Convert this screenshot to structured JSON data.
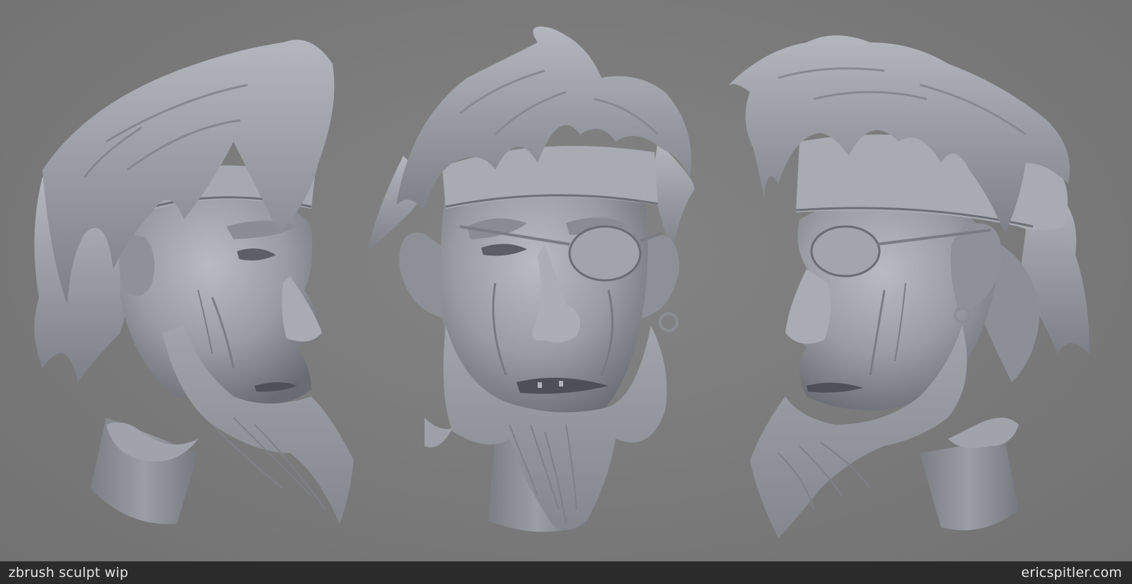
{
  "caption": {
    "left_text": "zbrush sculpt wip",
    "right_text": "ericspitler.com"
  },
  "image": {
    "subjects": [
      "bust-left-profile",
      "bust-front",
      "bust-right-profile"
    ],
    "colors": {
      "background": "#7a7a7a",
      "sculpt": "#9a9ca3",
      "shadow": "#5d5f66",
      "highlight": "#c3c5cc",
      "caption_bar": "#2b2b2b",
      "caption_text": "#e6e6e6"
    }
  }
}
